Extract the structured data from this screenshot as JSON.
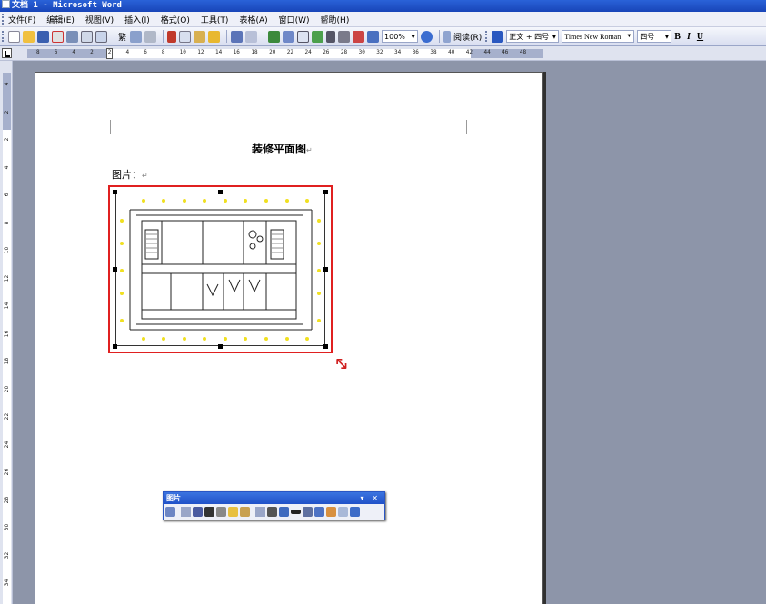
{
  "window": {
    "title": "文档 1 - Microsoft Word"
  },
  "menu": [
    "文件(F)",
    "编辑(E)",
    "视图(V)",
    "插入(I)",
    "格式(O)",
    "工具(T)",
    "表格(A)",
    "窗口(W)",
    "帮助(H)"
  ],
  "toolbar": {
    "zoom": "100%",
    "read_label": "阅读(R)",
    "style": "正文 + 四号",
    "font": "Times New Roman",
    "size": "四号",
    "bold": "B",
    "italic": "I",
    "underline": "U",
    "fan_label": "繁"
  },
  "ruler": {
    "h_numbers": [
      "8",
      "6",
      "4",
      "2",
      "2",
      "4",
      "6",
      "8",
      "10",
      "12",
      "14",
      "16",
      "18",
      "20",
      "22",
      "24",
      "26",
      "28",
      "30",
      "32",
      "34",
      "36",
      "38",
      "40",
      "42",
      "44",
      "46",
      "48"
    ],
    "v_numbers": [
      "4",
      "2",
      "2",
      "4",
      "6",
      "8",
      "10",
      "12",
      "14",
      "16",
      "18",
      "20",
      "22",
      "24",
      "26",
      "28",
      "30",
      "32",
      "34"
    ]
  },
  "document": {
    "heading": "装修平面图",
    "picture_label": "图片：",
    "paragraph_mark": "↵"
  },
  "picture_toolbar": {
    "title": "图片",
    "controls": "▾ ✕"
  },
  "colors": {
    "titlebar": "#2a62d8",
    "highlight_box": "#e02020",
    "workspace": "#8d95a9"
  }
}
